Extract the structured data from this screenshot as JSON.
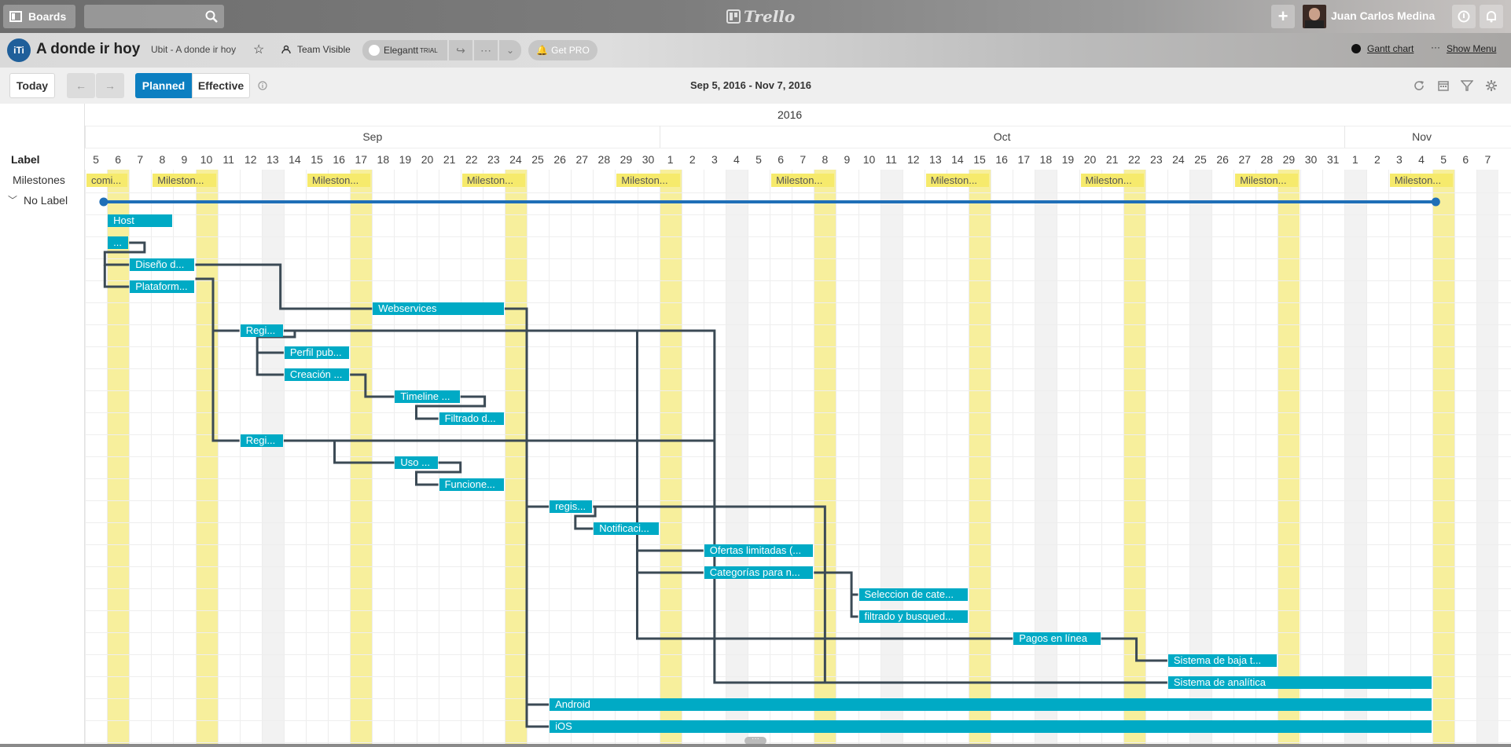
{
  "topbar": {
    "boards_label": "Boards",
    "search_placeholder": "",
    "logo_text": "Trello",
    "user_name": "Juan Carlos Medina"
  },
  "boardbar": {
    "org_initials": "iTi",
    "board_title": "A donde ir hoy",
    "team_board": "Ubit - A donde ir hoy",
    "visibility": "Team Visible",
    "powerup_name": "Elegantt",
    "trial_badge": "TRIAL",
    "get_pro": "Get PRO",
    "gantt_chart": "Gantt chart",
    "show_menu": "Show Menu"
  },
  "toolbar": {
    "today": "Today",
    "planned": "Planned",
    "effective": "Effective",
    "date_range": "Sep 5, 2016 - Nov 7, 2016"
  },
  "gantt": {
    "year": "2016",
    "months": [
      {
        "name": "Sep",
        "start": 0,
        "len": 26
      },
      {
        "name": "Oct",
        "start": 26,
        "len": 31
      },
      {
        "name": "Nov",
        "start": 57,
        "len": 7
      }
    ],
    "day_labels": [
      "5",
      "6",
      "7",
      "8",
      "9",
      "10",
      "11",
      "12",
      "13",
      "14",
      "15",
      "16",
      "17",
      "18",
      "19",
      "20",
      "21",
      "22",
      "23",
      "24",
      "25",
      "26",
      "27",
      "28",
      "29",
      "30",
      "1",
      "2",
      "3",
      "4",
      "5",
      "6",
      "7",
      "8",
      "9",
      "10",
      "11",
      "12",
      "13",
      "14",
      "15",
      "16",
      "17",
      "18",
      "19",
      "20",
      "21",
      "22",
      "23",
      "24",
      "25",
      "26",
      "27",
      "28",
      "29",
      "30",
      "31",
      "1",
      "2",
      "3",
      "4",
      "5",
      "6",
      "7"
    ],
    "weekend_days": [
      1,
      5,
      8,
      12,
      19,
      26,
      29,
      33,
      36,
      40,
      43,
      47,
      50,
      54,
      57,
      61,
      63
    ],
    "highlight_days": [
      1,
      5,
      12,
      19,
      26,
      33,
      40,
      47,
      54,
      61
    ],
    "label_header": "Label",
    "milestones_label": "Milestones",
    "group_label": "No Label",
    "milestones": [
      {
        "text": "comi...",
        "day": 0,
        "len": 2
      },
      {
        "text": "Mileston...",
        "day": 3,
        "len": 3
      },
      {
        "text": "Mileston...",
        "day": 10,
        "len": 3
      },
      {
        "text": "Mileston...",
        "day": 17,
        "len": 3
      },
      {
        "text": "Mileston...",
        "day": 24,
        "len": 3
      },
      {
        "text": "Mileston...",
        "day": 31,
        "len": 3
      },
      {
        "text": "Mileston...",
        "day": 38,
        "len": 3
      },
      {
        "text": "Mileston...",
        "day": 45,
        "len": 3
      },
      {
        "text": "Mileston...",
        "day": 52,
        "len": 3
      },
      {
        "text": "Mileston...",
        "day": 59,
        "len": 3
      }
    ],
    "tasks": [
      {
        "text": "Host",
        "row": 0,
        "start": 1,
        "len": 3
      },
      {
        "text": "...",
        "row": 1,
        "start": 1,
        "len": 1
      },
      {
        "text": "Diseño d...",
        "row": 2,
        "start": 2,
        "len": 3
      },
      {
        "text": "Plataform...",
        "row": 3,
        "start": 2,
        "len": 3
      },
      {
        "text": "Webservices",
        "row": 4,
        "start": 13,
        "len": 6
      },
      {
        "text": "Regi...",
        "row": 5,
        "start": 7,
        "len": 2
      },
      {
        "text": "Perfil pub...",
        "row": 6,
        "start": 9,
        "len": 3
      },
      {
        "text": "Creación ...",
        "row": 7,
        "start": 9,
        "len": 3
      },
      {
        "text": "Timeline ...",
        "row": 8,
        "start": 14,
        "len": 3
      },
      {
        "text": "Filtrado d...",
        "row": 9,
        "start": 16,
        "len": 3
      },
      {
        "text": "Regi...",
        "row": 10,
        "start": 7,
        "len": 2
      },
      {
        "text": "Uso ...",
        "row": 11,
        "start": 14,
        "len": 2
      },
      {
        "text": "Funcione...",
        "row": 12,
        "start": 16,
        "len": 3
      },
      {
        "text": "regis...",
        "row": 13,
        "start": 21,
        "len": 2
      },
      {
        "text": "Notificaci...",
        "row": 14,
        "start": 23,
        "len": 3
      },
      {
        "text": "Ofertas limitadas (...",
        "row": 15,
        "start": 28,
        "len": 5
      },
      {
        "text": "Categorías para n...",
        "row": 16,
        "start": 28,
        "len": 5
      },
      {
        "text": "Seleccion de cate...",
        "row": 17,
        "start": 35,
        "len": 5
      },
      {
        "text": "filtrado y busqued...",
        "row": 18,
        "start": 35,
        "len": 5
      },
      {
        "text": "Pagos en línea",
        "row": 19,
        "start": 42,
        "len": 4
      },
      {
        "text": "Sistema de baja t...",
        "row": 20,
        "start": 49,
        "len": 5
      },
      {
        "text": "Sistema de analítica",
        "row": 21,
        "start": 49,
        "len": 12
      },
      {
        "text": "Android",
        "row": 22,
        "start": 21,
        "len": 40
      },
      {
        "text": "iOS",
        "row": 23,
        "start": 21,
        "len": 40
      }
    ]
  }
}
